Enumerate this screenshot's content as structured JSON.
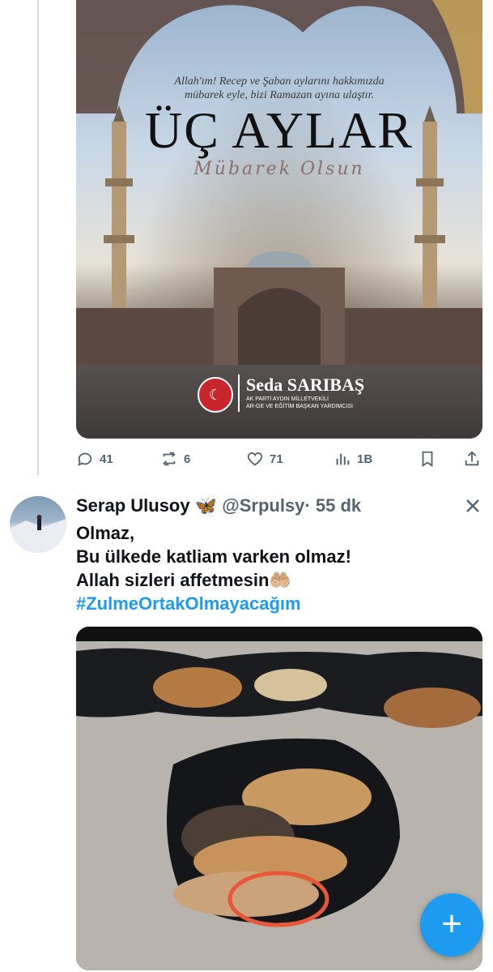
{
  "tweet1": {
    "image": {
      "caption_line1": "Allah'ım! Recep ve Şaban aylarını hakkımızda",
      "caption_line2": "mübarek eyle, bizi Ramazan ayına ulaştır.",
      "headline": "ÜÇ AYLAR",
      "script": "Mübarek Olsun",
      "signature_name": "Seda SARIBAŞ",
      "signature_sub1": "AK PARTİ AYDIN MİLLETVEKİLİ",
      "signature_sub2": "AR-GE VE EĞİTİM BAŞKAN YARDIMCISI"
    },
    "actions": {
      "replies": "41",
      "retweets": "6",
      "likes": "71",
      "views": "1B"
    }
  },
  "tweet2": {
    "author_name": "Serap Ulusoy",
    "author_emoji": "🦋",
    "handle": "@Srpulsy",
    "separator": "·",
    "time": "55 dk",
    "lines": [
      "Olmaz,",
      "Bu ülkede katliam varken olmaz!",
      "Allah sizleri affetmesin🤲🏼"
    ],
    "hashtag": "#ZulmeOrtakOlmayacağım"
  },
  "fab": {
    "label": "+"
  },
  "colors": {
    "accent": "#1d9bf0",
    "muted": "#536471",
    "text": "#0f1419"
  }
}
